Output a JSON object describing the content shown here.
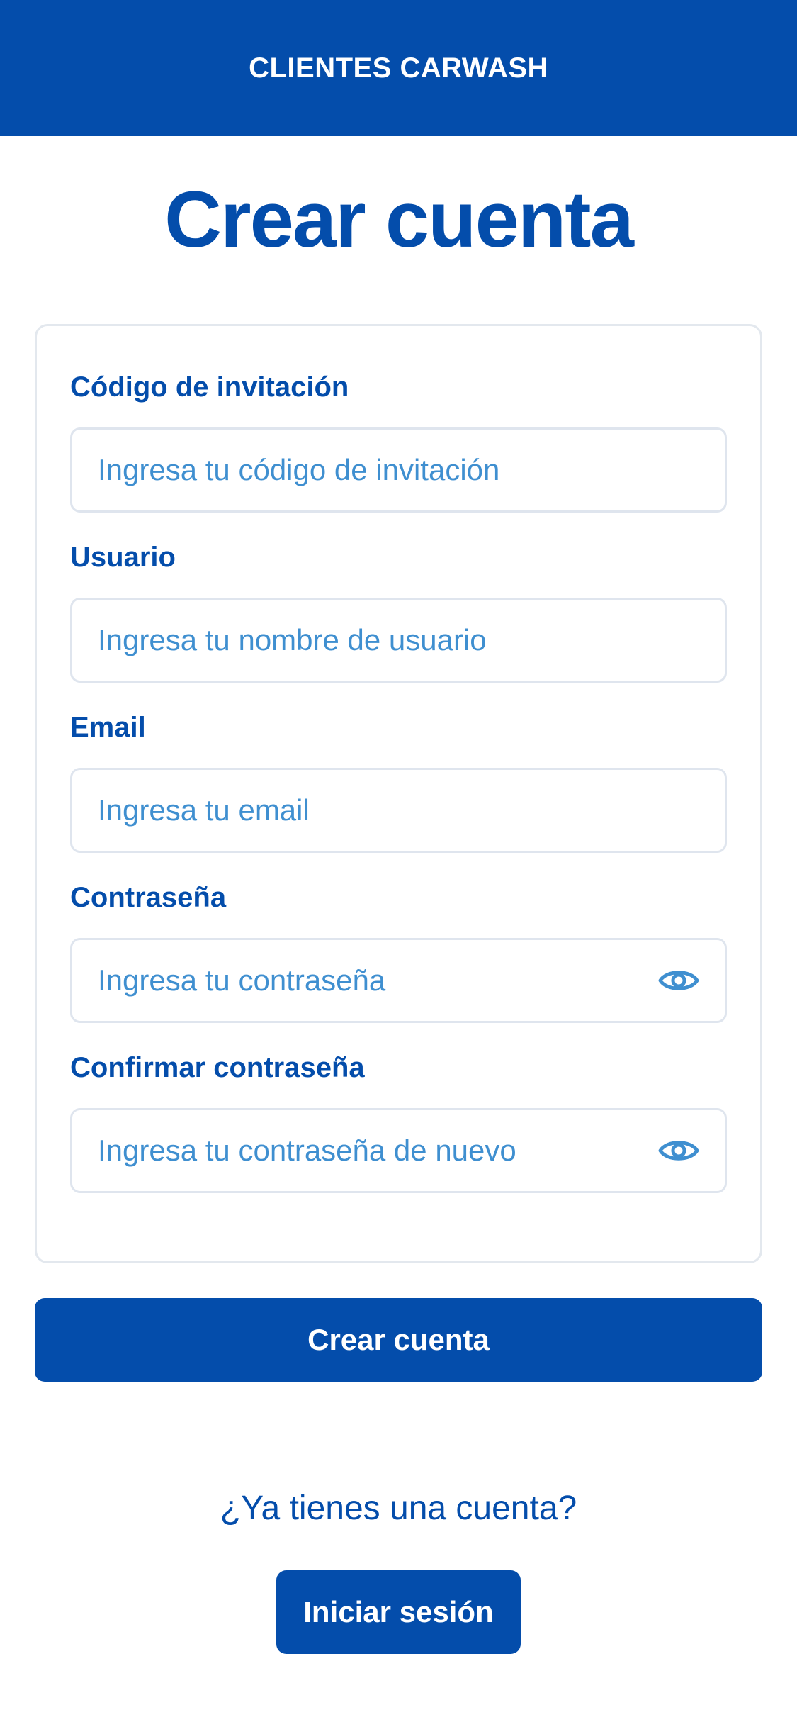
{
  "header": {
    "title": "CLIENTES CARWASH"
  },
  "page": {
    "title": "Crear cuenta"
  },
  "form": {
    "fields": [
      {
        "label": "Código de invitación",
        "placeholder": "Ingresa tu código de invitación",
        "value": ""
      },
      {
        "label": "Usuario",
        "placeholder": "Ingresa tu nombre de usuario",
        "value": ""
      },
      {
        "label": "Email",
        "placeholder": "Ingresa tu email",
        "value": ""
      },
      {
        "label": "Contraseña",
        "placeholder": "Ingresa tu contraseña",
        "value": "",
        "icon": "eye-icon"
      },
      {
        "label": "Confirmar contraseña",
        "placeholder": "Ingresa tu contraseña de nuevo",
        "value": "",
        "icon": "eye-icon"
      }
    ],
    "submit_label": "Crear cuenta"
  },
  "login": {
    "prompt": "¿Ya tienes una cuenta?",
    "button_label": "Iniciar sesión"
  },
  "colors": {
    "primary": "#044dab",
    "placeholder": "#3f8fd0",
    "border": "#dfe5ee",
    "background": "#ffffff"
  }
}
